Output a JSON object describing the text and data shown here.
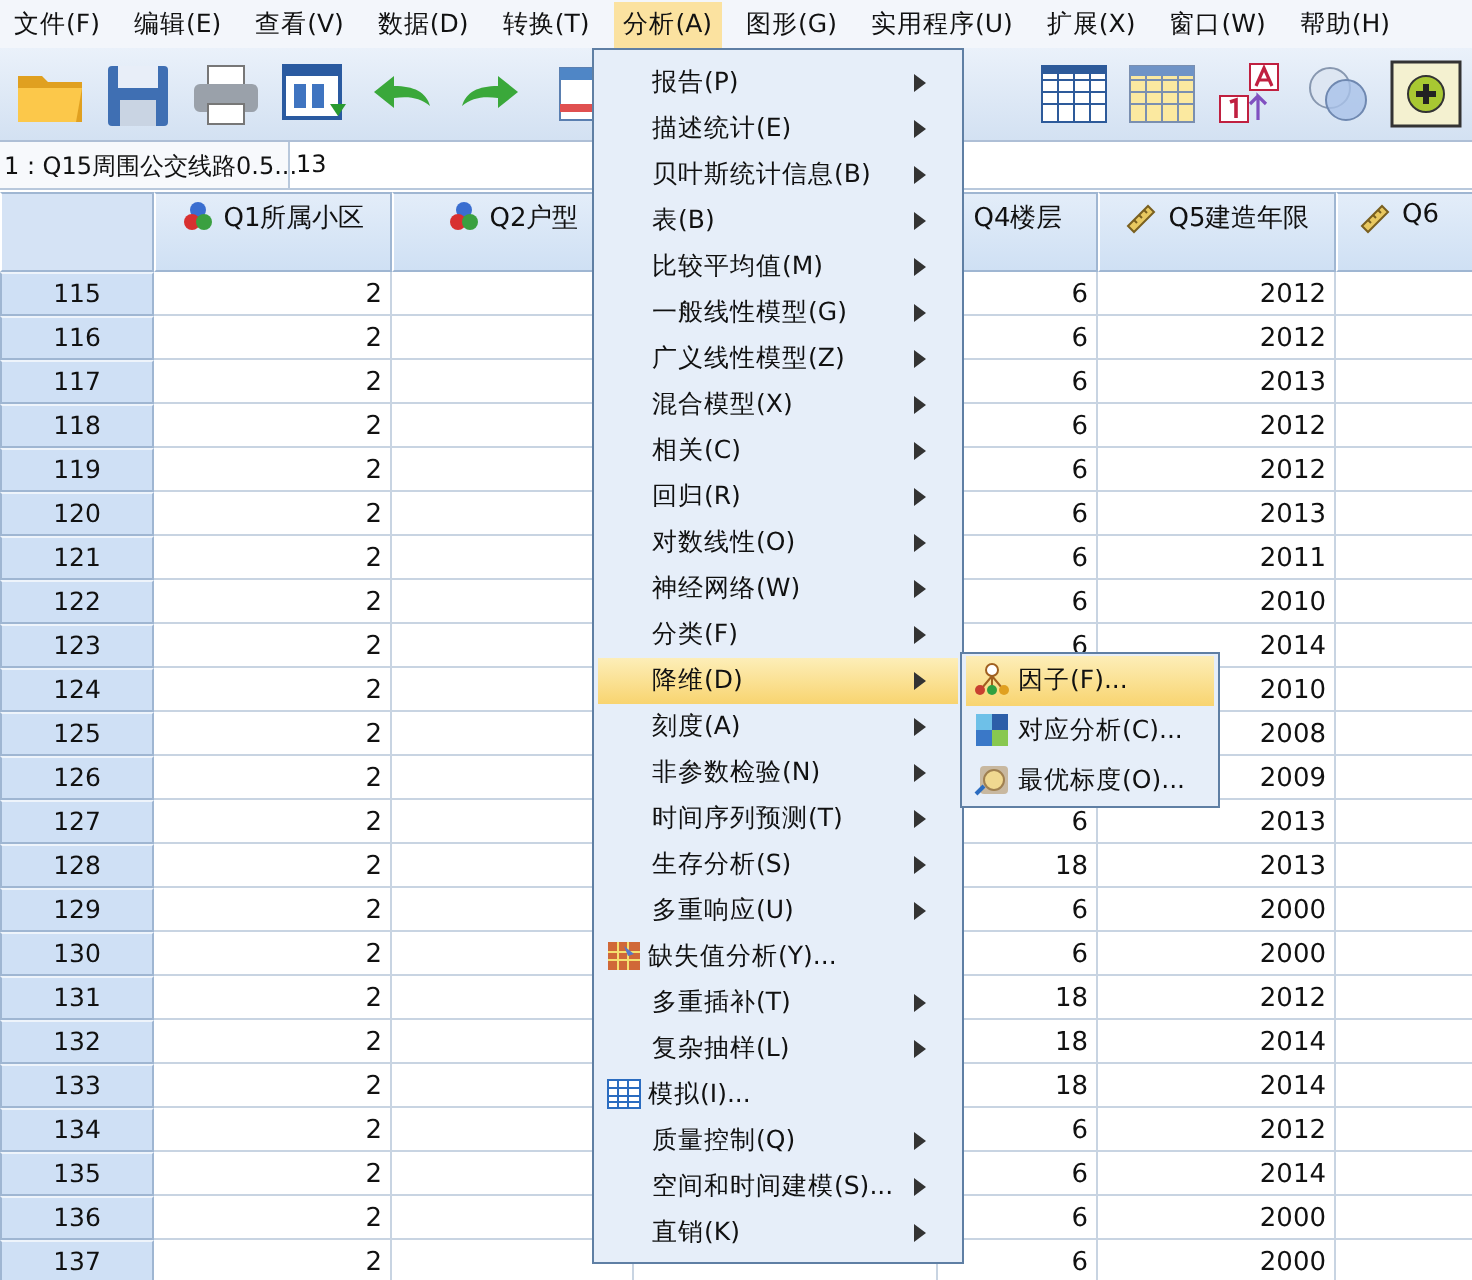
{
  "menu_bar": [
    {
      "label": "文件(F)",
      "selected": false
    },
    {
      "label": "编辑(E)",
      "selected": false
    },
    {
      "label": "查看(V)",
      "selected": false
    },
    {
      "label": "数据(D)",
      "selected": false
    },
    {
      "label": "转换(T)",
      "selected": false
    },
    {
      "label": "分析(A)",
      "selected": true
    },
    {
      "label": "图形(G)",
      "selected": false
    },
    {
      "label": "实用程序(U)",
      "selected": false
    },
    {
      "label": "扩展(X)",
      "selected": false
    },
    {
      "label": "窗口(W)",
      "selected": false
    },
    {
      "label": "帮助(H)",
      "selected": false
    }
  ],
  "cell_reference": {
    "variable": "1 : Q15周围公交线路0.5...",
    "value": "13"
  },
  "table": {
    "columns": [
      {
        "label": "Q1所属小区",
        "kind": "nominal"
      },
      {
        "label": "Q2户型",
        "kind": "nominal"
      },
      {
        "label": "Q4楼层",
        "kind": "plain"
      },
      {
        "label": "Q5建造年限",
        "kind": "scale"
      },
      {
        "label": "Q6",
        "kind": "scale"
      }
    ],
    "rows": [
      {
        "number": "115",
        "cells": [
          "2",
          null,
          "6",
          "2012",
          null
        ]
      },
      {
        "number": "116",
        "cells": [
          "2",
          null,
          "6",
          "2012",
          null
        ]
      },
      {
        "number": "117",
        "cells": [
          "2",
          null,
          "6",
          "2013",
          null
        ]
      },
      {
        "number": "118",
        "cells": [
          "2",
          null,
          "6",
          "2012",
          null
        ]
      },
      {
        "number": "119",
        "cells": [
          "2",
          null,
          "6",
          "2012",
          null
        ]
      },
      {
        "number": "120",
        "cells": [
          "2",
          null,
          "6",
          "2013",
          null
        ]
      },
      {
        "number": "121",
        "cells": [
          "2",
          null,
          "6",
          "2011",
          null
        ]
      },
      {
        "number": "122",
        "cells": [
          "2",
          null,
          "6",
          "2010",
          null
        ]
      },
      {
        "number": "123",
        "cells": [
          "2",
          null,
          "6",
          "2014",
          null
        ]
      },
      {
        "number": "124",
        "cells": [
          "2",
          null,
          null,
          "2010",
          null
        ]
      },
      {
        "number": "125",
        "cells": [
          "2",
          null,
          null,
          "2008",
          null
        ]
      },
      {
        "number": "126",
        "cells": [
          "2",
          null,
          null,
          "2009",
          null
        ]
      },
      {
        "number": "127",
        "cells": [
          "2",
          null,
          "6",
          "2013",
          null
        ]
      },
      {
        "number": "128",
        "cells": [
          "2",
          null,
          "18",
          "2013",
          null
        ]
      },
      {
        "number": "129",
        "cells": [
          "2",
          null,
          "6",
          "2000",
          null
        ]
      },
      {
        "number": "130",
        "cells": [
          "2",
          null,
          "6",
          "2000",
          null
        ]
      },
      {
        "number": "131",
        "cells": [
          "2",
          null,
          "18",
          "2012",
          null
        ]
      },
      {
        "number": "132",
        "cells": [
          "2",
          null,
          "18",
          "2014",
          null
        ]
      },
      {
        "number": "133",
        "cells": [
          "2",
          null,
          "18",
          "2014",
          null
        ]
      },
      {
        "number": "134",
        "cells": [
          "2",
          null,
          "6",
          "2012",
          null
        ]
      },
      {
        "number": "135",
        "cells": [
          "2",
          null,
          "6",
          "2014",
          null
        ]
      },
      {
        "number": "136",
        "cells": [
          "2",
          null,
          "6",
          "2000",
          null
        ]
      },
      {
        "number": "137",
        "cells": [
          "2",
          null,
          "6",
          "2000",
          null
        ]
      }
    ]
  },
  "menu": {
    "items": [
      {
        "label": "报告(P)",
        "kind": "submenu",
        "selected": false
      },
      {
        "label": "描述统计(E)",
        "kind": "submenu",
        "selected": false
      },
      {
        "label": "贝叶斯统计信息(B)",
        "kind": "submenu",
        "selected": false
      },
      {
        "label": "表(B)",
        "kind": "submenu",
        "selected": false
      },
      {
        "label": "比较平均值(M)",
        "kind": "submenu",
        "selected": false
      },
      {
        "label": "一般线性模型(G)",
        "kind": "submenu",
        "selected": false
      },
      {
        "label": "广义线性模型(Z)",
        "kind": "submenu",
        "selected": false
      },
      {
        "label": "混合模型(X)",
        "kind": "submenu",
        "selected": false
      },
      {
        "label": "相关(C)",
        "kind": "submenu",
        "selected": false
      },
      {
        "label": "回归(R)",
        "kind": "submenu",
        "selected": false
      },
      {
        "label": "对数线性(O)",
        "kind": "submenu",
        "selected": false
      },
      {
        "label": "神经网络(W)",
        "kind": "submenu",
        "selected": false
      },
      {
        "label": "分类(F)",
        "kind": "submenu",
        "selected": false
      },
      {
        "label": "降维(D)",
        "kind": "submenu",
        "selected": true
      },
      {
        "label": "刻度(A)",
        "kind": "submenu",
        "selected": false
      },
      {
        "label": "非参数检验(N)",
        "kind": "submenu",
        "selected": false
      },
      {
        "label": "时间序列预测(T)",
        "kind": "submenu",
        "selected": false
      },
      {
        "label": "生存分析(S)",
        "kind": "submenu",
        "selected": false
      },
      {
        "label": "多重响应(U)",
        "kind": "submenu",
        "selected": false
      },
      {
        "label": "缺失值分析(Y)...",
        "kind": "dialog",
        "selected": false
      },
      {
        "label": "多重插补(T)",
        "kind": "submenu",
        "selected": false
      },
      {
        "label": "复杂抽样(L)",
        "kind": "submenu",
        "selected": false
      },
      {
        "label": "模拟(I)...",
        "kind": "dialog",
        "selected": false
      },
      {
        "label": "质量控制(Q)",
        "kind": "submenu",
        "selected": false
      },
      {
        "label": "空间和时间建模(S)...",
        "kind": "submenu",
        "selected": false
      },
      {
        "label": "直销(K)",
        "kind": "submenu",
        "selected": false
      }
    ]
  },
  "submenu": {
    "items": [
      {
        "label": "因子(F)...",
        "selected": true
      },
      {
        "label": "对应分析(C)...",
        "selected": false
      },
      {
        "label": "最优标度(O)...",
        "selected": false
      }
    ]
  }
}
